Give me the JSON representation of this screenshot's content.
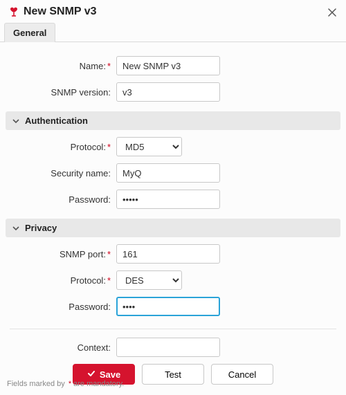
{
  "header": {
    "title": "New SNMP v3"
  },
  "tabs": {
    "general": "General"
  },
  "general": {
    "name_label": "Name:",
    "name_value": "New SNMP v3",
    "version_label": "SNMP version:",
    "version_value": "v3"
  },
  "auth": {
    "section_title": "Authentication",
    "protocol_label": "Protocol:",
    "protocol_value": "MD5",
    "secname_label": "Security name:",
    "secname_value": "MyQ",
    "password_label": "Password:",
    "password_value": "•••••"
  },
  "privacy": {
    "section_title": "Privacy",
    "port_label": "SNMP port:",
    "port_value": "161",
    "protocol_label": "Protocol:",
    "protocol_value": "DES",
    "password_label": "Password:",
    "password_value": "••••"
  },
  "context": {
    "label": "Context:",
    "value": ""
  },
  "buttons": {
    "save": "Save",
    "test": "Test",
    "cancel": "Cancel"
  },
  "footer": {
    "prefix": "Fields marked by ",
    "suffix": " are mandatory."
  }
}
